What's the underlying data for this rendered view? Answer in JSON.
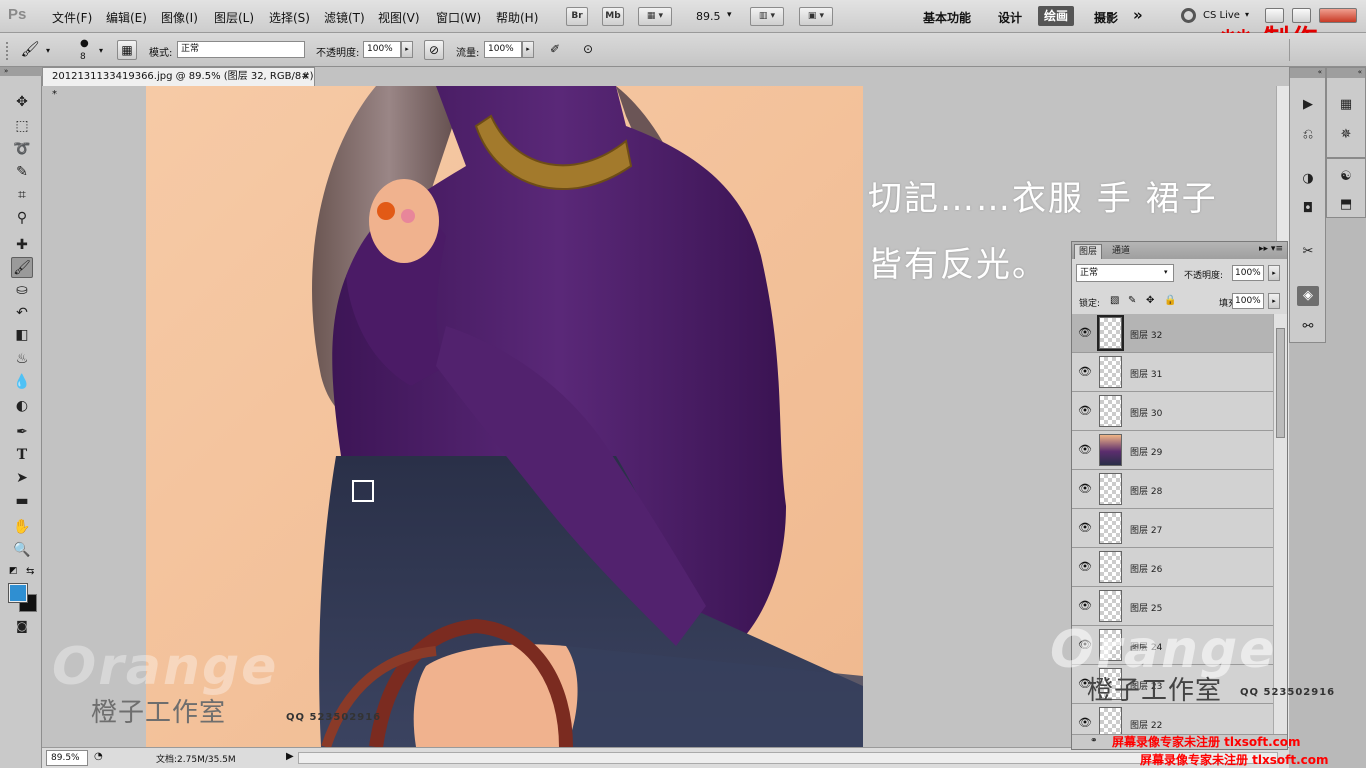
{
  "app": {
    "logo": "Ps"
  },
  "menu": {
    "items": [
      "文件(F)",
      "编辑(E)",
      "图像(I)",
      "图层(L)",
      "选择(S)",
      "滤镜(T)",
      "视图(V)",
      "窗口(W)",
      "帮助(H)"
    ]
  },
  "menubar": {
    "bridge_label": "Br",
    "minibridge_label": "Mb",
    "zoom_value": "89.5",
    "workspaces": [
      "基本功能",
      "设计",
      "绘画",
      "摄影"
    ],
    "active_workspace": "绘画",
    "more": "»",
    "cslive": "CS Live",
    "watermark_made": "** 制作"
  },
  "options": {
    "brush_size": "8",
    "mode_label": "模式:",
    "mode_value": "正常",
    "opacity_label": "不透明度:",
    "opacity_value": "100%",
    "flow_label": "流量:",
    "flow_value": "100%"
  },
  "document": {
    "tab_title": "2012131133419366.jpg @ 89.5% (图层 32, RGB/8#) *",
    "close_glyph": "×",
    "overlay_line1": "切記……衣服 手 裙子",
    "overlay_line2": "皆有反光。"
  },
  "status": {
    "zoom": "89.5%",
    "doc_info": "文档:2.75M/35.5M"
  },
  "layers_panel": {
    "tab_layers": "图层",
    "tab_paths": "通道",
    "menu_glyph": "▸▸ ▾≡",
    "blend_mode": "正常",
    "opacity_label": "不透明度:",
    "opacity_value": "100%",
    "lock_label": "锁定:",
    "fill_label": "填充:",
    "fill_value": "100%",
    "layers": [
      {
        "name": "图层 32",
        "selected": true,
        "thumb": "transparent"
      },
      {
        "name": "图层 31",
        "selected": false,
        "thumb": "transparent"
      },
      {
        "name": "图层 30",
        "selected": false,
        "thumb": "transparent"
      },
      {
        "name": "图层 29",
        "selected": false,
        "thumb": "photo"
      },
      {
        "name": "图层 28",
        "selected": false,
        "thumb": "transparent"
      },
      {
        "name": "图层 27",
        "selected": false,
        "thumb": "transparent"
      },
      {
        "name": "图层 26",
        "selected": false,
        "thumb": "transparent"
      },
      {
        "name": "图层 25",
        "selected": false,
        "thumb": "transparent"
      },
      {
        "name": "图层 24",
        "selected": false,
        "thumb": "transparent"
      },
      {
        "name": "图层 23",
        "selected": false,
        "thumb": "transparent"
      },
      {
        "name": "图层 22",
        "selected": false,
        "thumb": "transparent"
      }
    ]
  },
  "watermarks": {
    "studio": "橙子工作室",
    "orange": "Orange",
    "qq": "QQ 523502916",
    "qq_right": "QQ 523502916",
    "soft": "屏幕录像专家未注册 tlxsoft.com"
  },
  "colors": {
    "foreground": "#2f8fd2",
    "background": "#111111",
    "canvas_bg": "#f3c39e",
    "sweater": "#4b1e66",
    "skirt": "#2e3450",
    "watermark_red": "#ff0000"
  }
}
